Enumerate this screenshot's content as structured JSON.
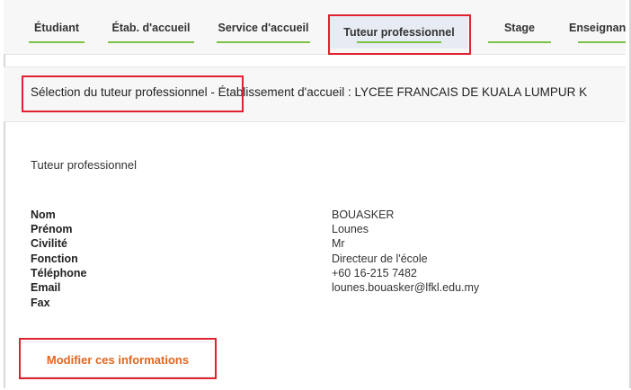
{
  "tabs": [
    {
      "label": "Étudiant",
      "active": false
    },
    {
      "label": "Étab. d'accueil",
      "active": false
    },
    {
      "label": "Service d'accueil",
      "active": false
    },
    {
      "label": "Tuteur professionnel",
      "active": true
    },
    {
      "label": "Stage",
      "active": false
    },
    {
      "label": "Enseignant",
      "active": false
    }
  ],
  "header": {
    "selection_text": "Sélection du tuteur professionnel - Établissement d'accueil : LYCEE FRANCAIS DE KUALA LUMPUR K"
  },
  "section": {
    "title": "Tuteur professionnel"
  },
  "fields": [
    {
      "label": "Nom",
      "value": "BOUASKER"
    },
    {
      "label": "Prénom",
      "value": "Lounes"
    },
    {
      "label": "Civilité",
      "value": "Mr"
    },
    {
      "label": "Fonction",
      "value": "Directeur de l'école"
    },
    {
      "label": "Téléphone",
      "value": "+60 16-215 7482"
    },
    {
      "label": "Email",
      "value": "lounes.bouasker@lfkl.edu.my"
    },
    {
      "label": "Fax",
      "value": ""
    }
  ],
  "actions": {
    "modify_label": "Modifier ces informations"
  },
  "colors": {
    "tab_underline": "#7cc243",
    "highlight_box": "#e0212f",
    "button_text": "#e0661f"
  }
}
